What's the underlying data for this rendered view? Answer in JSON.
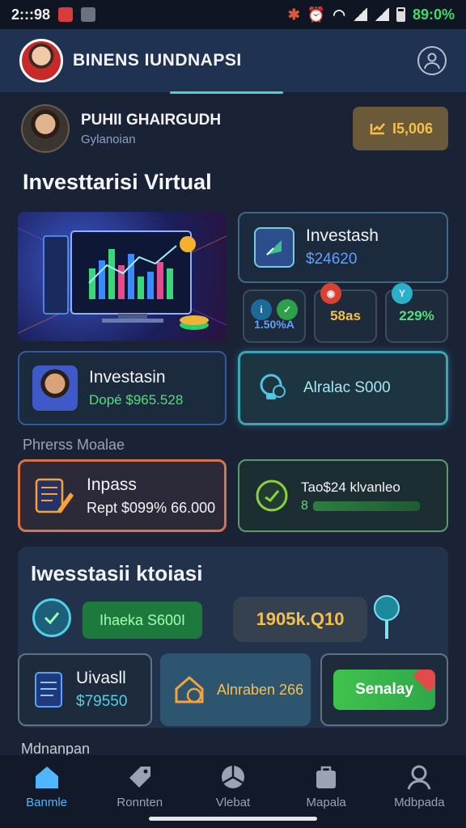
{
  "status_bar": {
    "time": "2:::98",
    "battery": "89:0%"
  },
  "header": {
    "title": "BINENS IUNDNAPSI"
  },
  "user": {
    "name": "PUHII GHAIRGUDH",
    "subtitle": "Gylanoian",
    "coins": "I5,006"
  },
  "section_title": "Investtarisi Virtual",
  "invest_card": {
    "title": "Investash",
    "value": "$24620"
  },
  "mini_stats": [
    "1.50%A",
    "58as",
    "229%"
  ],
  "profile_card": {
    "title": "Investasin",
    "value": "Dopé $965.528"
  },
  "alert_card": {
    "label": "Alralac S000"
  },
  "faint_label": "Phrerss Moalae",
  "inpass_card": {
    "title": "Inpass",
    "value": "Rept $099% 66.000"
  },
  "tao_card": {
    "title": "Tao$24 klvanleo",
    "value": "8",
    "progress": 0.88
  },
  "panel": {
    "title": "Iwesstasii ktoiasi",
    "green_pill": "Ihaeka S600I",
    "dark_pill": "1905k.Q10"
  },
  "uivasll_card": {
    "title": "Uivasll",
    "value": "$79550"
  },
  "alnraben_card": {
    "label": "Alnraben 266"
  },
  "senalay_button": "Senalay",
  "bottom_label": "Mdnanpan",
  "nav": [
    {
      "label": "Banmle",
      "icon": "home-icon",
      "active": true
    },
    {
      "label": "Ronnten",
      "icon": "tag-icon",
      "active": false
    },
    {
      "label": "Vlebat",
      "icon": "pie-icon",
      "active": false
    },
    {
      "label": "Mapala",
      "icon": "bag-icon",
      "active": false
    },
    {
      "label": "Mdbpada",
      "icon": "user-icon",
      "active": false
    }
  ],
  "colors": {
    "accent": "#4fd1c5",
    "background": "#1a2236",
    "coin": "#f5c04a",
    "positive": "#4fe07a",
    "nav_active": "#4fb6ff"
  }
}
